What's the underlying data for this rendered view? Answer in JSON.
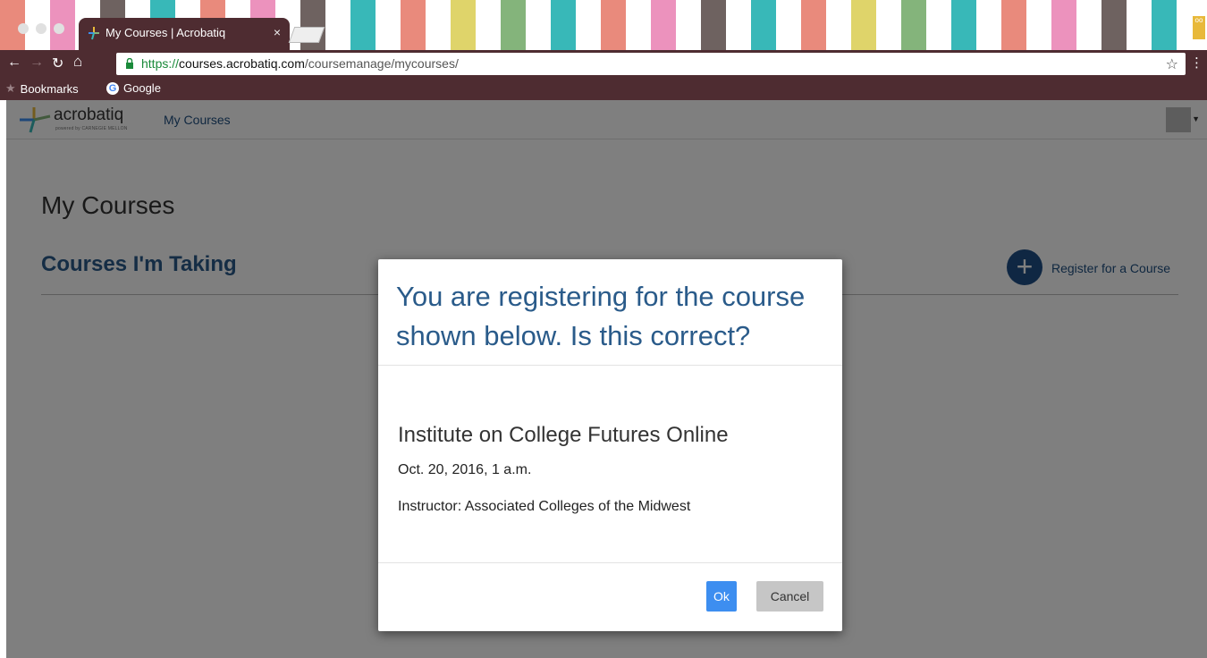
{
  "browser": {
    "tab_title": "My Courses | Acrobatiq",
    "tab_close": "×",
    "url_scheme": "https://",
    "url_host": "courses.acrobatiq.com",
    "url_path": "/coursemanage/mycourses/",
    "bookmarks_label": "Bookmarks",
    "bookmark_google": "Google"
  },
  "app": {
    "logo_text": "acrobatiq",
    "logo_sub": "powered by CARNEGIE MELLON",
    "nav_my_courses": "My Courses"
  },
  "page": {
    "title": "My Courses",
    "section_title": "Courses I'm Taking",
    "register_icon": "+",
    "register_label": "Register for a Course"
  },
  "modal": {
    "title": "You are registering for the course shown below. Is this correct?",
    "course_name": "Institute on College Futures Online",
    "course_date": "Oct. 20, 2016, 1 a.m.",
    "course_instructor": "Instructor: Associated Colleges of the Midwest",
    "ok_label": "Ok",
    "cancel_label": "Cancel"
  },
  "colors": {
    "chrome": "#4e2c31",
    "brand_blue": "#2a5b8a",
    "ok_blue": "#3d8ef0"
  }
}
